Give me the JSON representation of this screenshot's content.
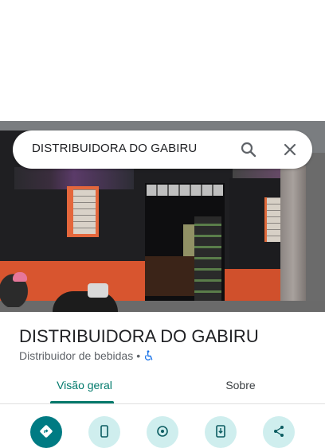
{
  "search": {
    "query": "DISTRIBUIDORA DO GABIRU",
    "search_icon": "search-icon",
    "close_icon": "close-icon"
  },
  "place": {
    "name": "DISTRIBUIDORA DO GABIRU",
    "category": "Distribuidor de bebidas",
    "separator": "•",
    "accessibility_icon": "wheelchair-icon"
  },
  "tabs": [
    {
      "label": "Visão geral",
      "selected": true
    },
    {
      "label": "Sobre",
      "selected": false
    }
  ],
  "actions": [
    {
      "icon": "directions-icon"
    },
    {
      "icon": "phone-icon"
    },
    {
      "icon": "nearby-icon"
    },
    {
      "icon": "save-to-phone-icon"
    },
    {
      "icon": "share-icon"
    }
  ],
  "colors": {
    "accent": "#00796b",
    "primary_action": "#007b83",
    "action_bg": "#cfeeee",
    "wheelchair": "#1a73e8"
  }
}
